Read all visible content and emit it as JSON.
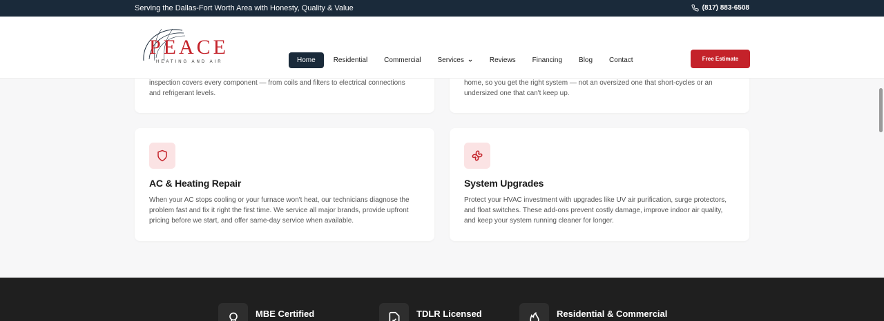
{
  "topbar": {
    "tagline": "Serving the Dallas-Fort Worth Area with Honesty, Quality & Value",
    "phone": "(817) 883-6508",
    "phone_icon": "phone-icon"
  },
  "header": {
    "logo_text": "PEACE",
    "logo_sub": "HEATING AND AIR",
    "nav": [
      {
        "label": "Home"
      },
      {
        "label": "Residential"
      },
      {
        "label": "Commercial"
      },
      {
        "label": "Services"
      },
      {
        "label": "Reviews"
      },
      {
        "label": "Financing"
      },
      {
        "label": "Blog"
      },
      {
        "label": "Contact"
      }
    ],
    "cta_label": "Free Estimate"
  },
  "cards": [
    {
      "title": "",
      "lines": [
        "inspection covers every component — from coils and filters to electrical connections",
        "and refrigerant levels."
      ]
    },
    {
      "title": "",
      "lines": [
        "home, so you get the right system — not an oversized one that short-cycles or an",
        "undersized one that can't keep up."
      ]
    },
    {
      "title": "AC & Heating Repair",
      "icon": "shield-icon",
      "lines": [
        "When your AC stops cooling or your furnace won't heat, our technicians diagnose the",
        "problem fast and fix it right the first time. We service all major brands, provide upfront",
        "pricing before we start, and offer same-day service when available."
      ]
    },
    {
      "title": "System Upgrades",
      "icon": "fan-icon",
      "lines": [
        "Protect your HVAC investment with upgrades like UV air purification, surge protectors,",
        "and float switches. These add-ons prevent costly damage, improve indoor air quality,",
        "and keep your system running cleaner for longer."
      ]
    }
  ],
  "badges": [
    {
      "label": "MBE Certified",
      "icon": "award-icon"
    },
    {
      "label": "TDLR Licensed",
      "icon": "document-check-icon"
    },
    {
      "label": "Residential & Commercial",
      "icon": "flame-icon"
    }
  ],
  "colors": {
    "brand_red": "#c4222a",
    "navy": "#1a2a3a",
    "icon_bg": "#fbe3e4",
    "footer_bg": "#1f1f1f"
  }
}
